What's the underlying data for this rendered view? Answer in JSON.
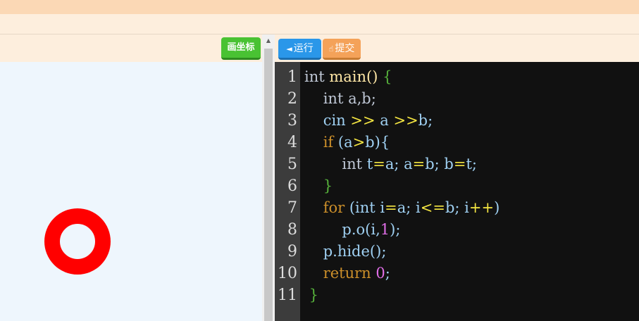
{
  "toolbar": {
    "coord_label": "画坐标",
    "run_label": "运行",
    "run_icon": "◄",
    "submit_label": "提交",
    "submit_icon": "☝"
  },
  "editor": {
    "line_numbers": [
      "1",
      "2",
      "3",
      "4",
      "5",
      "6",
      "7",
      "8",
      "9",
      "10",
      "11"
    ]
  },
  "code": {
    "l1": {
      "a": "int",
      "b": " main() ",
      "c": "{"
    },
    "l2": {
      "a": "    int ",
      "b": "a,b;"
    },
    "l3": {
      "a": "    cin ",
      "b": ">>",
      "c": " a ",
      "d": ">>",
      "e": "b;"
    },
    "l4": {
      "a": "    ",
      "b": "if",
      "c": " (a",
      "d": ">",
      "e": "b){"
    },
    "l5": {
      "a": "        int ",
      "b": "t",
      "c": "=",
      "d": "a; a",
      "e": "=",
      "f": "b; b",
      "g": "=",
      "h": "t;"
    },
    "l6": {
      "a": "    }"
    },
    "l7": {
      "a": "    ",
      "b": "for",
      "c": " (int i",
      "d": "=",
      "e": "a; i",
      "f": "<=",
      "g": "b; i",
      "h": "++",
      "i": ")"
    },
    "l8": {
      "a": "        p.o(i,",
      "b": "1",
      "c": ");"
    },
    "l9": {
      "a": "    p.hide();"
    },
    "l10": {
      "a": "    ",
      "b": "return",
      "c": " ",
      "d": "0",
      "e": ";"
    },
    "l11": {
      "a": " }"
    }
  },
  "colors": {
    "ring": "#ff0000",
    "run_button": "#2a97e9",
    "submit_button": "#f4a259",
    "coord_button": "#49c233"
  }
}
